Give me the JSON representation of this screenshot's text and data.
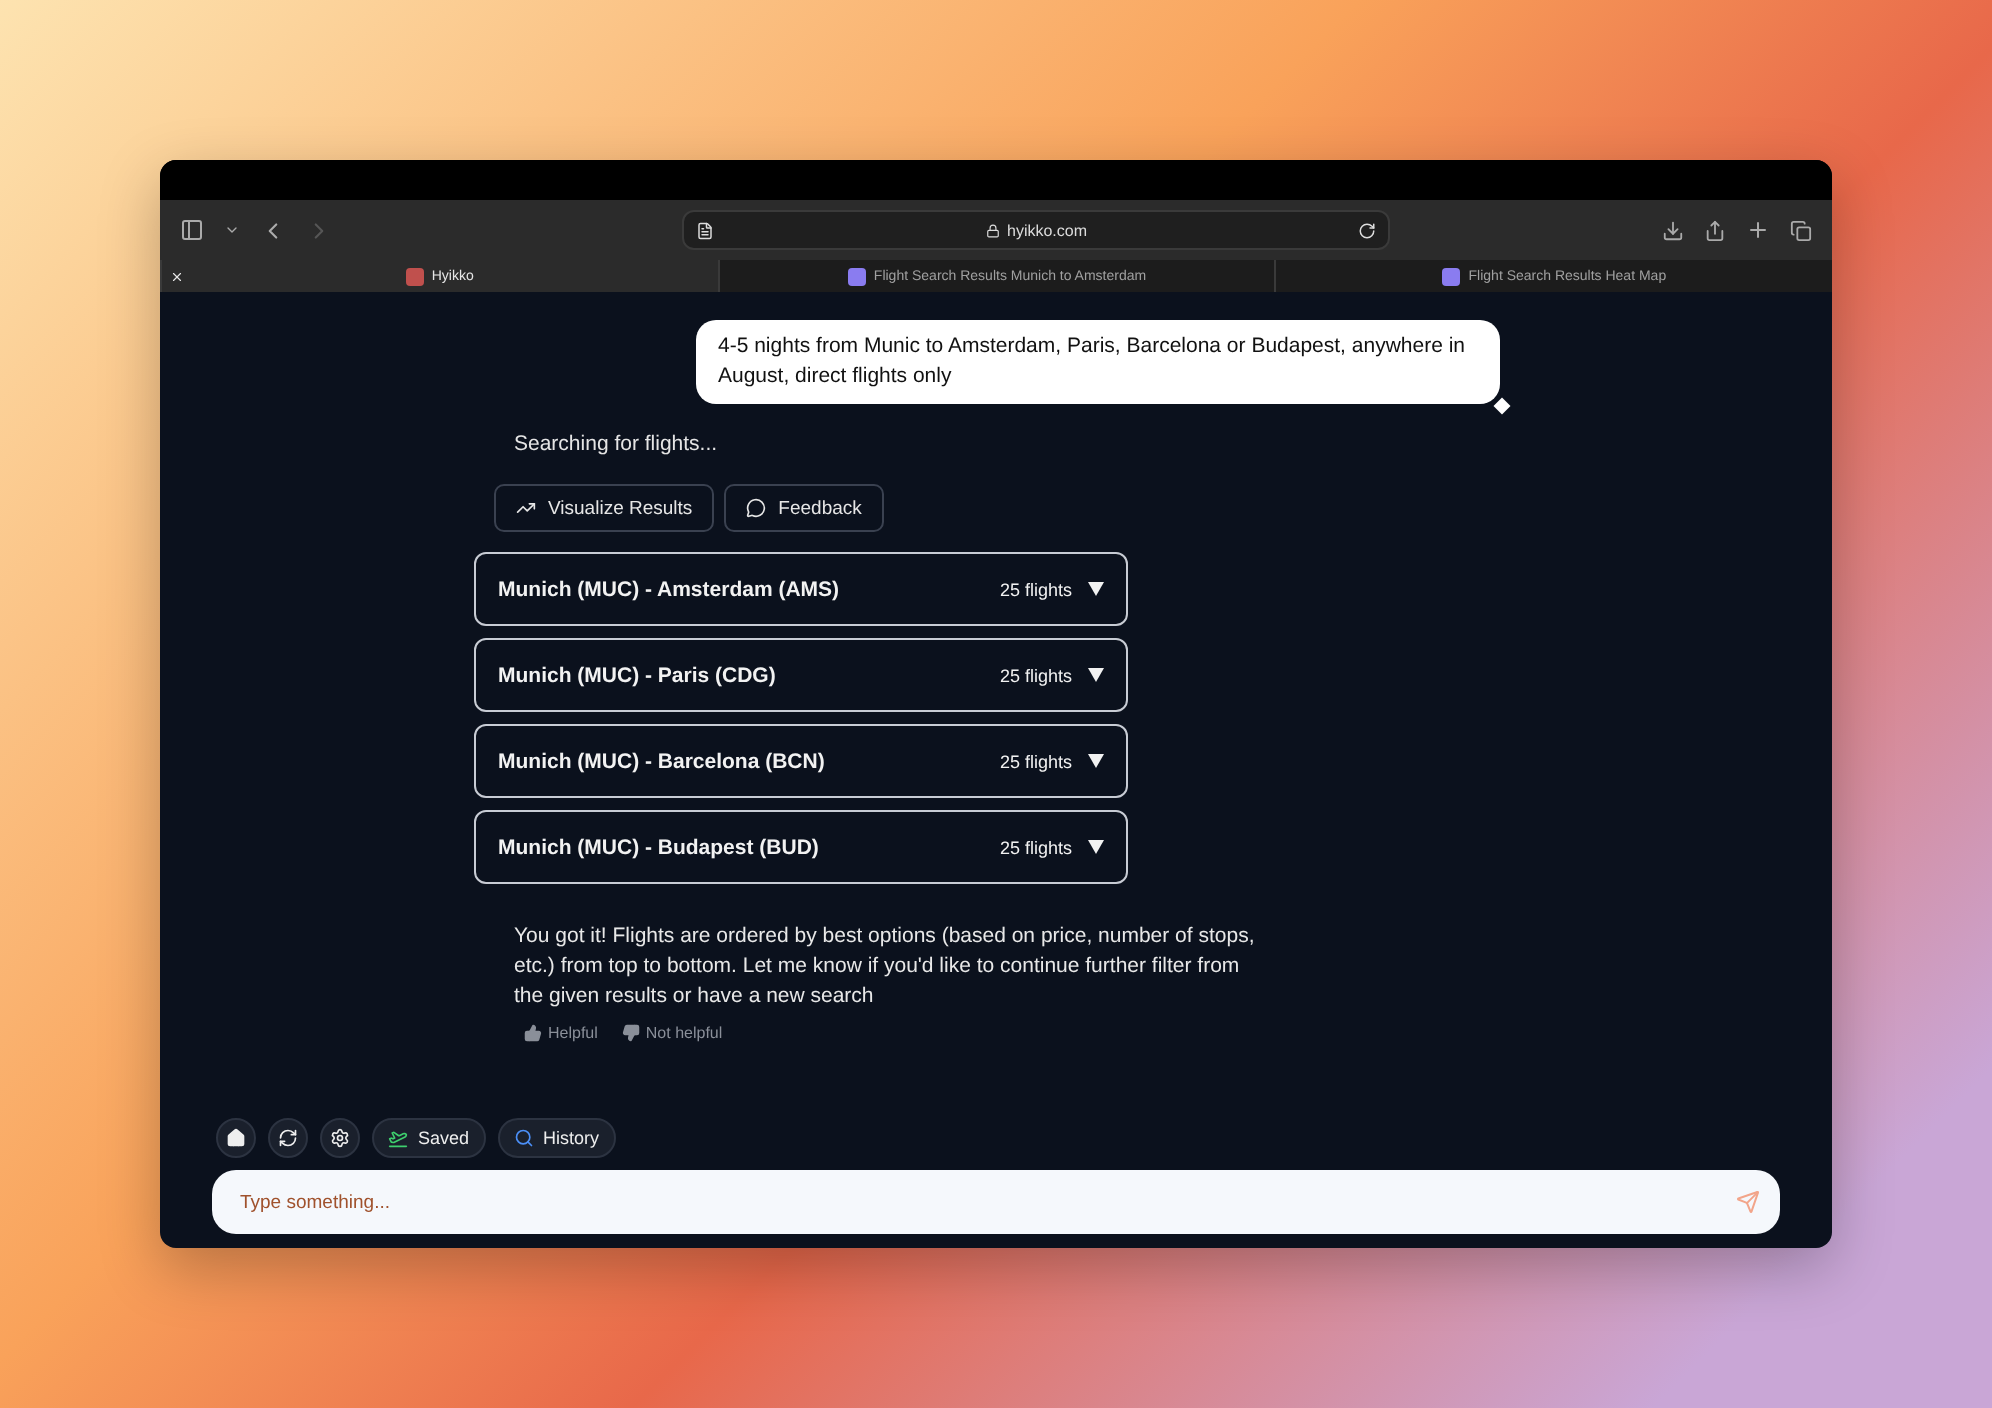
{
  "browser": {
    "url": "hyikko.com",
    "tabs": [
      {
        "title": "Hyikko",
        "selected": true
      },
      {
        "title": "Flight Search Results Munich to Amsterdam",
        "selected": false
      },
      {
        "title": "Flight Search Results Heat Map",
        "selected": false
      }
    ]
  },
  "chat": {
    "user_message": "4-5 nights from Munic to Amsterdam, Paris, Barcelona or Budapest, anywhere in August, direct flights only",
    "status": "Searching for flights...",
    "actions": [
      {
        "label": "Visualize Results",
        "kind": "chart"
      },
      {
        "label": "Feedback",
        "kind": "feedback"
      }
    ],
    "routes": [
      {
        "route": "Munich (MUC) - Amsterdam (AMS)",
        "count": "25 flights",
        "expanded": false
      },
      {
        "route": "Munich (MUC) - Paris (CDG)",
        "count": "25 flights",
        "expanded": false
      },
      {
        "route": "Munich (MUC) - Barcelona (BCN)",
        "count": "25 flights",
        "expanded": false
      },
      {
        "route": "Munich (MUC) - Budapest (BUD)",
        "count": "25 flights",
        "expanded": false
      }
    ],
    "reply": "You got it! Flights are ordered by best options (based on price, number of stops, etc.) from top to bottom. Let me know if you'd like to continue further filter from the given results or have a new search",
    "feedback": [
      {
        "label": "Helpful",
        "kind": "up"
      },
      {
        "label": "Not helpful",
        "kind": "down"
      }
    ]
  },
  "toolbar": [
    {
      "kind": "home"
    },
    {
      "kind": "refresh"
    },
    {
      "kind": "settings"
    },
    {
      "kind": "saved",
      "label": "Saved"
    },
    {
      "kind": "history",
      "label": "History"
    }
  ],
  "composer": {
    "placeholder": "Type something..."
  }
}
